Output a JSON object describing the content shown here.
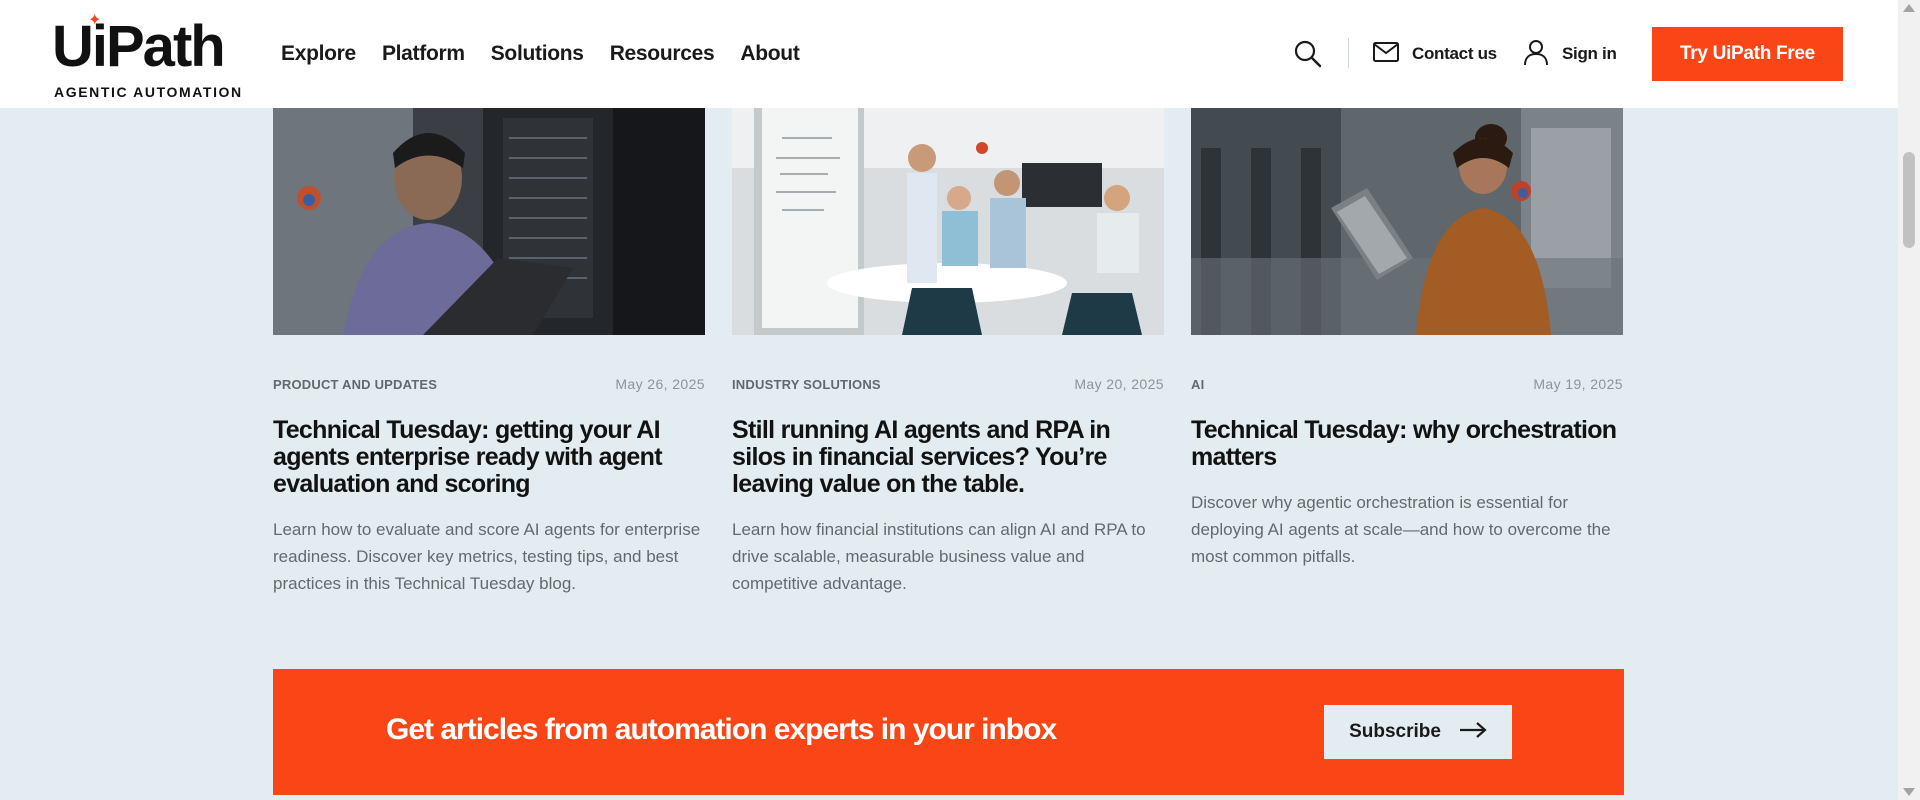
{
  "header": {
    "logo": {
      "wordmark": "UiPath",
      "tagline": "AGENTIC AUTOMATION"
    },
    "nav": [
      "Explore",
      "Platform",
      "Solutions",
      "Resources",
      "About"
    ],
    "contact_label": "Contact us",
    "signin_label": "Sign in",
    "cta_label": "Try UiPath Free",
    "icons": {
      "search": "search-icon",
      "contact": "mail-icon",
      "signin": "user-icon"
    }
  },
  "cards": [
    {
      "category": "PRODUCT AND UPDATES",
      "date": "May 26, 2025",
      "title": "Technical Tuesday: getting your AI agents enterprise ready with agent evaluation and scoring",
      "description": "Learn how to evaluate and score AI agents for enterprise readiness. Discover key metrics, testing tips, and best practices in this Technical Tuesday blog."
    },
    {
      "category": "INDUSTRY SOLUTIONS",
      "date": "May 20, 2025",
      "title": "Still running AI agents and RPA in silos in financial services? You’re leaving value on the table.",
      "description": "Learn how financial institutions can align AI and RPA to drive scalable, measurable business value and competitive advantage."
    },
    {
      "category": "AI",
      "date": "May 19, 2025",
      "title": "Technical Tuesday: why orchestration matters",
      "description": "Discover why agentic orchestration is essential for deploying AI agents at scale—and how to overcome the most common pitfalls."
    }
  ],
  "banner": {
    "text": "Get articles from automation experts in your inbox",
    "button_label": "Subscribe"
  },
  "colors": {
    "brand_orange": "#fa4616",
    "page_bg": "#e3edf1",
    "text_dark": "#121212",
    "text_muted": "#606b70"
  }
}
